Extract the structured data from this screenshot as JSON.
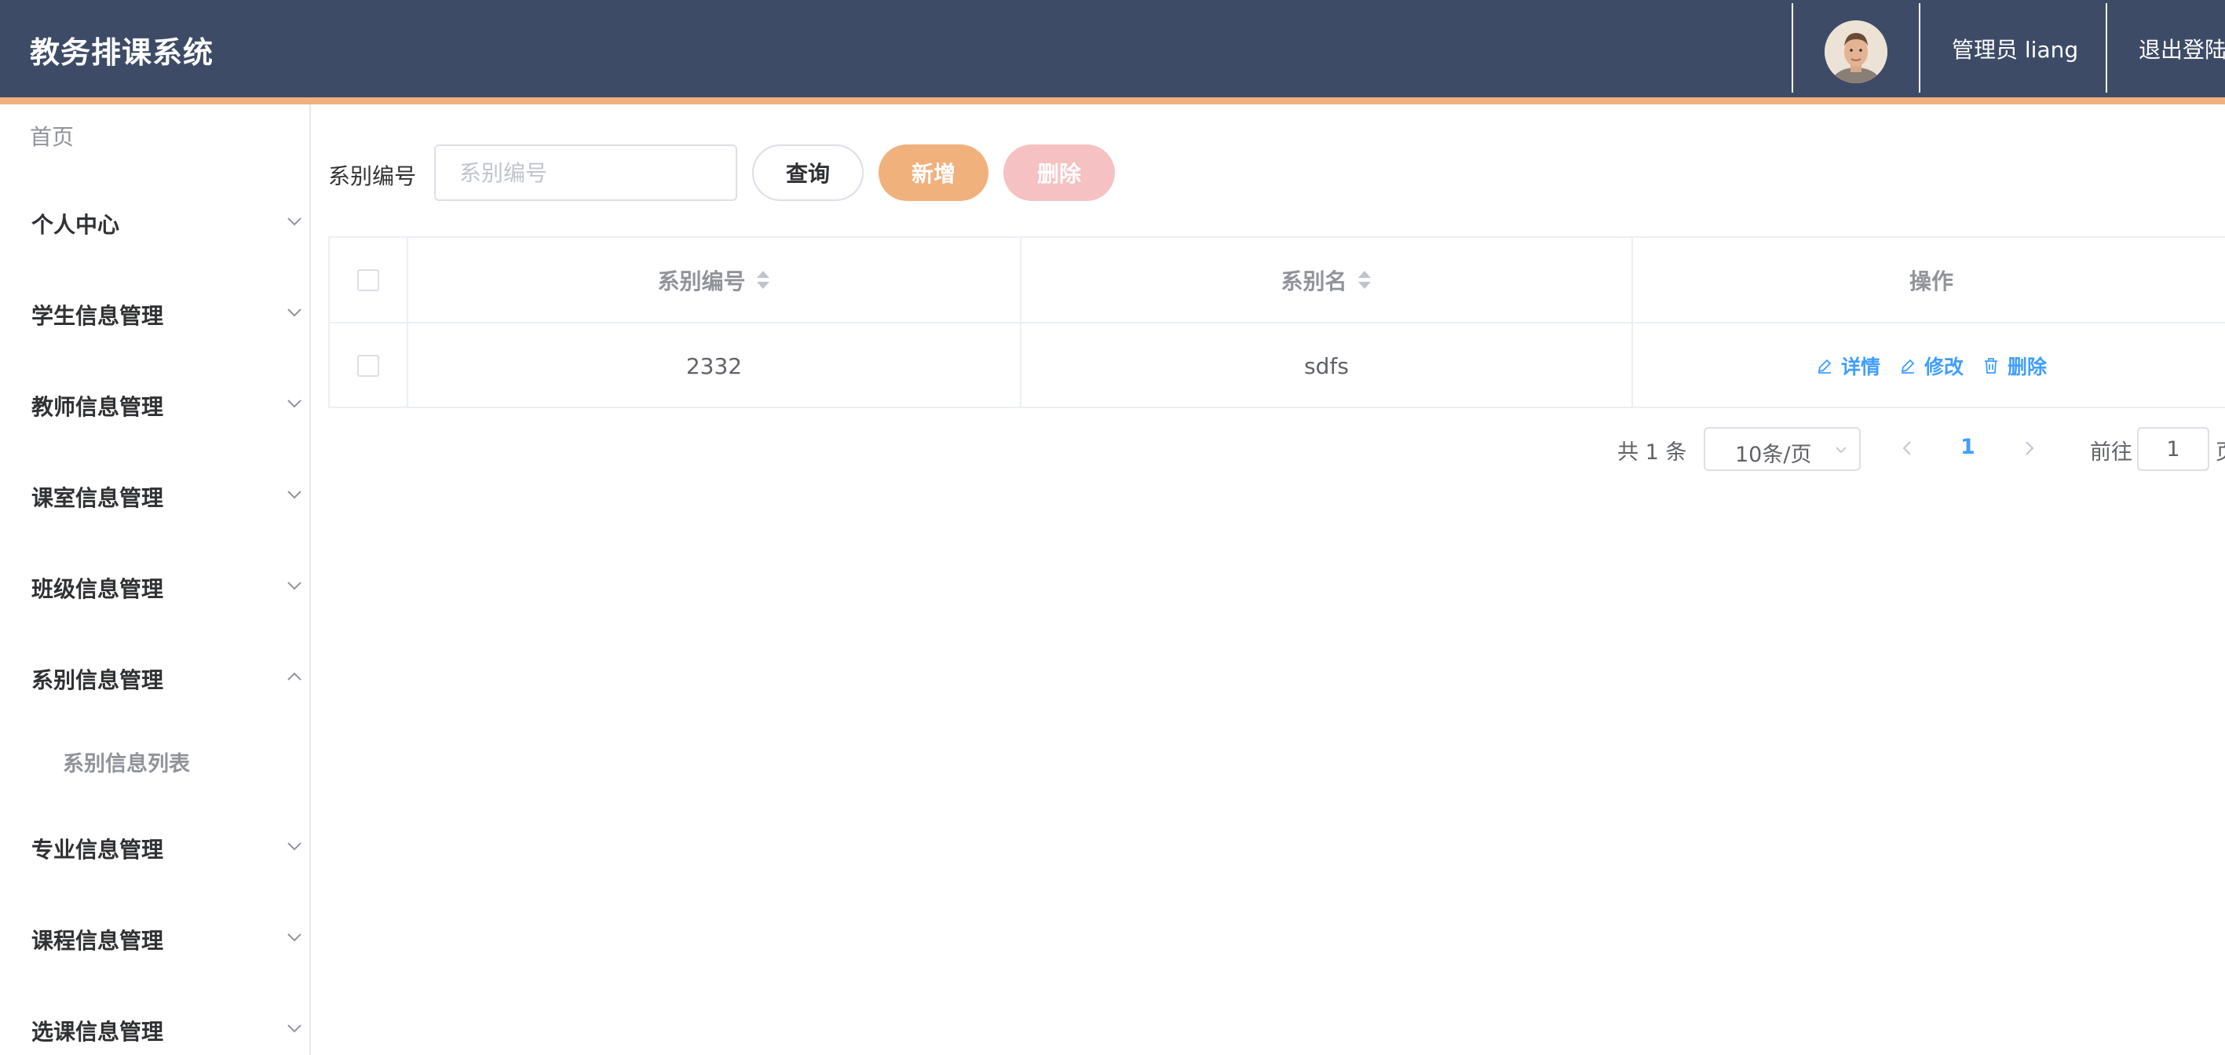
{
  "header": {
    "title": "教务排课系统",
    "user_label": "管理员 liang",
    "logout_label": "退出登陆"
  },
  "sidebar": {
    "home_label": "首页",
    "items": [
      {
        "label": "个人中心",
        "expanded": false
      },
      {
        "label": "学生信息管理",
        "expanded": false
      },
      {
        "label": "教师信息管理",
        "expanded": false
      },
      {
        "label": "课室信息管理",
        "expanded": false
      },
      {
        "label": "班级信息管理",
        "expanded": false
      },
      {
        "label": "系别信息管理",
        "expanded": true,
        "children": [
          {
            "label": "系别信息列表"
          }
        ]
      },
      {
        "label": "专业信息管理",
        "expanded": false
      },
      {
        "label": "课程信息管理",
        "expanded": false
      },
      {
        "label": "选课信息管理",
        "expanded": false
      }
    ]
  },
  "search": {
    "label": "系别编号",
    "placeholder": "系别编号",
    "value": "",
    "query_label": "查询",
    "add_label": "新增",
    "delete_label": "删除"
  },
  "table": {
    "columns": [
      "系别编号",
      "系别名",
      "操作"
    ],
    "rows": [
      {
        "code": "2332",
        "name": "sdfs",
        "checked": false
      }
    ],
    "actions": [
      "详情",
      "修改",
      "删除"
    ]
  },
  "pagination": {
    "total_label": "共 1 条",
    "page_size_label": "10条/页",
    "current_page": "1",
    "goto_label": "前往",
    "goto_value": "1",
    "page_suffix": "页"
  },
  "colors": {
    "header_bg": "#3d4b66",
    "accent": "#f0b17d",
    "danger_light": "#f5c1c2",
    "link": "#409eff"
  }
}
